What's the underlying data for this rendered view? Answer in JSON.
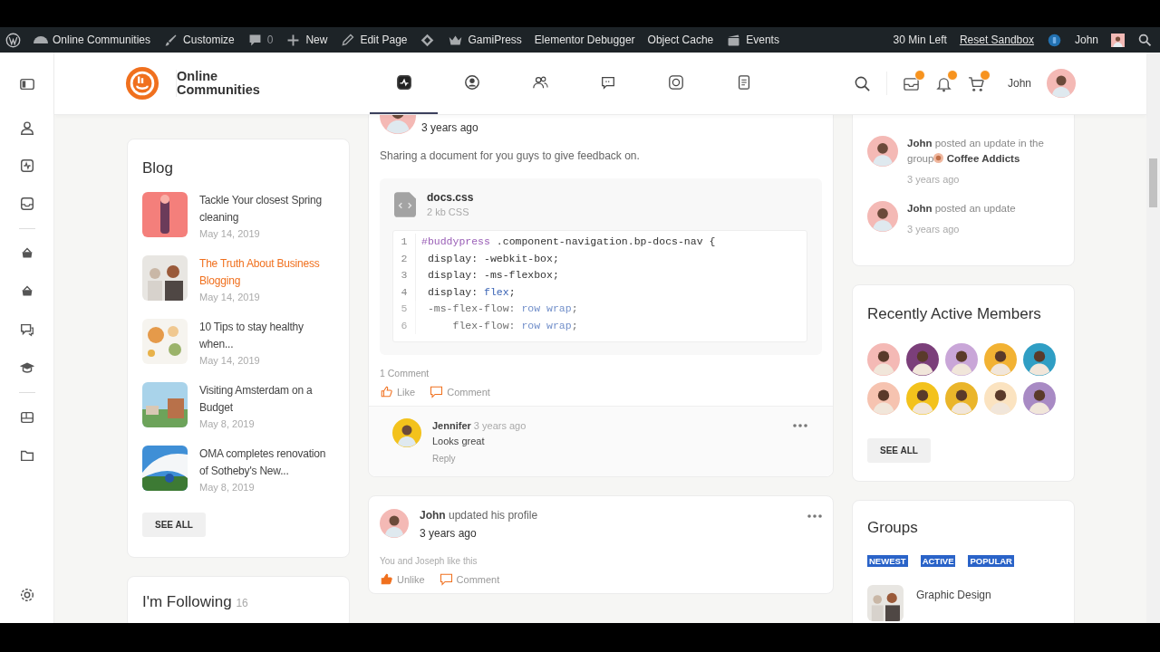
{
  "admin_bar": {
    "items": [
      {
        "kind": "wordpress"
      },
      {
        "kind": "site",
        "label": "Online Communities"
      },
      {
        "kind": "customize",
        "label": "Customize"
      },
      {
        "kind": "comments",
        "label": "0"
      },
      {
        "kind": "new",
        "label": "New"
      },
      {
        "kind": "edit",
        "label": "Edit Page"
      },
      {
        "kind": "diamond"
      },
      {
        "kind": "gamipress",
        "label": "GamiPress"
      },
      {
        "kind": "text",
        "label": "Elementor Debugger"
      },
      {
        "kind": "text",
        "label": "Object Cache"
      },
      {
        "kind": "events",
        "label": "Events"
      }
    ],
    "timer": "30 Min Left",
    "reset": "Reset Sandbox",
    "user": "John"
  },
  "header": {
    "site_name": "Online Communities",
    "nav": [
      {
        "selected": true
      },
      {
        "selected": false
      },
      {
        "selected": false
      },
      {
        "selected": false
      },
      {
        "selected": false
      },
      {
        "selected": false
      }
    ],
    "user": "John"
  },
  "blog": {
    "title": "Blog",
    "posts": [
      {
        "title": "Tackle Your closest Spring cleaning",
        "date": "May 14, 2019",
        "hovered": false
      },
      {
        "title": "The Truth About Business Blogging",
        "date": "May 14, 2019",
        "hovered": true
      },
      {
        "title": "10 Tips to stay healthy when...",
        "date": "May 14, 2019",
        "hovered": false
      },
      {
        "title": "Visiting Amsterdam on a Budget",
        "date": "May 8, 2019",
        "hovered": false
      },
      {
        "title": "OMA completes renovation of Sotheby's New...",
        "date": "May 8, 2019",
        "hovered": false
      }
    ],
    "button": "SEE ALL"
  },
  "following": {
    "title": "I'm Following",
    "count": "16"
  },
  "activity_post": {
    "time": "3 years ago",
    "text": "Sharing a document for you guys to give feedback on.",
    "attachment": {
      "name": "docs.css",
      "meta": "2 kb CSS",
      "lines": [
        {
          "num": "1",
          "faded": false,
          "tokens": [
            {
              "kind": "selector",
              "text": "#buddypress"
            },
            {
              "kind": "plain",
              "text": " .component-navigation.bp-docs-nav {"
            }
          ]
        },
        {
          "num": "2",
          "faded": false,
          "tokens": [
            {
              "kind": "plain",
              "text": " display: -webkit-box;"
            }
          ]
        },
        {
          "num": "3",
          "faded": false,
          "tokens": [
            {
              "kind": "plain",
              "text": " display: -ms-flexbox;"
            }
          ]
        },
        {
          "num": "4",
          "faded": false,
          "tokens": [
            {
              "kind": "plain",
              "text": " display: "
            },
            {
              "kind": "value",
              "text": "flex"
            },
            {
              "kind": "plain",
              "text": ";"
            }
          ]
        },
        {
          "num": "5",
          "faded": true,
          "tokens": [
            {
              "kind": "plain",
              "text": " -ms-flex-flow: "
            },
            {
              "kind": "value",
              "text": "row wrap"
            },
            {
              "kind": "plain",
              "text": ";"
            }
          ]
        },
        {
          "num": "6",
          "faded": true,
          "tokens": [
            {
              "kind": "plain",
              "text": "     flex-flow: "
            },
            {
              "kind": "value",
              "text": "row wrap"
            },
            {
              "kind": "plain",
              "text": ";"
            }
          ]
        }
      ]
    },
    "comment_count": "1 Comment",
    "like": {
      "label": "Like",
      "liked": false
    },
    "comment_label": "Comment",
    "comments": [
      {
        "author": "Jennifer",
        "time": "3 years ago",
        "text": "Looks great",
        "reply": "Reply"
      }
    ]
  },
  "profile_update": {
    "text": "**John** updated his profile",
    "time": "3 years ago",
    "likes": "You and Joseph like this",
    "like": {
      "label": "Unlike",
      "liked": true
    },
    "comment_label": "Comment"
  },
  "activity": [
    {
      "text": "**John** posted an update in the group",
      "group": "Coffee Addicts",
      "time": "3 years ago"
    },
    {
      "text": "**John** posted an update",
      "time": "3 years ago"
    }
  ],
  "members": {
    "title": "Recently Active Members",
    "people": [
      {
        "color": "#f4b9b5"
      },
      {
        "color": "#7b3f7a"
      },
      {
        "color": "#c9a6d8"
      },
      {
        "color": "#f2b233"
      },
      {
        "color": "#2f9ec4"
      },
      {
        "color": "#f6c3b0"
      },
      {
        "color": "#f3c21c"
      },
      {
        "color": "#eab52a"
      },
      {
        "color": "#fbe3c0"
      },
      {
        "color": "#a88ac4"
      }
    ],
    "button": "SEE ALL"
  },
  "groups": {
    "title": "Groups",
    "tabs": [
      "NEWEST",
      "ACTIVE",
      "POPULAR"
    ],
    "items": [
      {
        "name": "Graphic Design"
      }
    ]
  }
}
